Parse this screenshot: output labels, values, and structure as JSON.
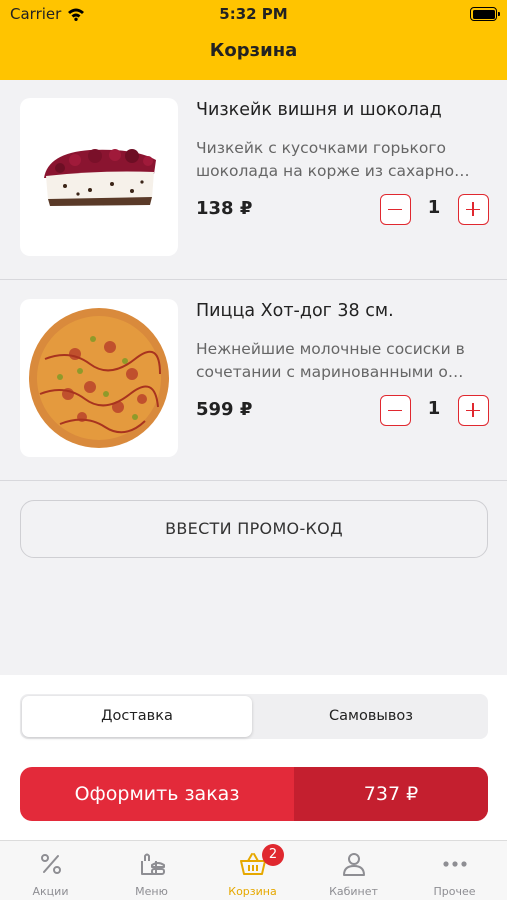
{
  "status_bar": {
    "carrier": "Carrier",
    "time": "5:32 PM"
  },
  "header": {
    "title": "Корзина"
  },
  "cart": {
    "items": [
      {
        "name": "Чизкейк вишня и шоколад",
        "description_lines": [
          "Чизкейк с кусочками горького",
          "шоколада на корже из сахарно…"
        ],
        "price": "138 ₽",
        "quantity": "1"
      },
      {
        "name": "Пицца Хот-дог 38 см.",
        "description_lines": [
          "Нежнейшие молочные сосиски  в",
          "сочетании с маринованными о…"
        ],
        "price": "599 ₽",
        "quantity": "1"
      }
    ],
    "promo_label": "ВВЕСТИ ПРОМО-КОД"
  },
  "delivery": {
    "options": [
      "Доставка",
      "Самовывоз"
    ],
    "selected": "Доставка"
  },
  "order": {
    "label": "Оформить заказ",
    "total": "737 ₽"
  },
  "tabbar": {
    "items": [
      {
        "label": "Акции",
        "icon": "percent-icon"
      },
      {
        "label": "Меню",
        "icon": "menu-food-icon"
      },
      {
        "label": "Корзина",
        "icon": "basket-icon"
      },
      {
        "label": "Кабинет",
        "icon": "person-icon"
      },
      {
        "label": "Прочее",
        "icon": "more-dots-icon"
      }
    ],
    "active": "Корзина",
    "cart_badge": "2"
  },
  "colors": {
    "header": "#ffc400",
    "accent": "#e32a3a",
    "active_tab": "#e6a800"
  }
}
